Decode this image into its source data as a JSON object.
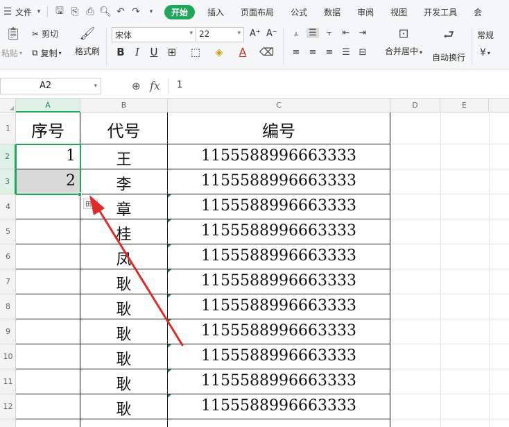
{
  "menu": {
    "file_label": "文件",
    "tabs": [
      "开始",
      "插入",
      "页面布局",
      "公式",
      "数据",
      "审阅",
      "视图",
      "开发工具",
      "会"
    ]
  },
  "ribbon": {
    "paste_label": "粘贴",
    "cut_label": "剪切",
    "copy_label": "复制",
    "format_painter_label": "格式刷",
    "font_name": "宋体",
    "font_size": "22",
    "bold": "B",
    "italic": "I",
    "underline": "U",
    "merge_label": "合并居中",
    "wrap_label": "自动换行",
    "number_format": "常规",
    "currency_symbol": "¥"
  },
  "formula_bar": {
    "cell_ref": "A2",
    "fx_label": "fx",
    "value": "1"
  },
  "grid": {
    "columns": [
      "A",
      "B",
      "C",
      "D",
      "E"
    ],
    "rows": [
      "1",
      "2",
      "3",
      "4",
      "5",
      "6",
      "7",
      "8",
      "9",
      "10",
      "11",
      "12"
    ],
    "header": {
      "a": "序号",
      "b": "代号",
      "c": "编号"
    },
    "data_rows": [
      {
        "a": "1",
        "b": "王",
        "c": "1155588996663333"
      },
      {
        "a": "2",
        "b": "李",
        "c": "1155588996663333"
      },
      {
        "a": "",
        "b": "章",
        "c": "1155588996663333"
      },
      {
        "a": "",
        "b": "桂",
        "c": "1155588996663333"
      },
      {
        "a": "",
        "b": "凤",
        "c": "1155588996663333"
      },
      {
        "a": "",
        "b": "耿",
        "c": "1155588996663333"
      },
      {
        "a": "",
        "b": "耿",
        "c": "1155588996663333"
      },
      {
        "a": "",
        "b": "耿",
        "c": "1155588996663333"
      },
      {
        "a": "",
        "b": "耿",
        "c": "1155588996663333"
      },
      {
        "a": "",
        "b": "耿",
        "c": "1155588996663333"
      },
      {
        "a": "",
        "b": "耿",
        "c": "1155588996663333"
      }
    ]
  },
  "colors": {
    "accent": "#1ea65a",
    "arrow": "#e02a2a"
  }
}
